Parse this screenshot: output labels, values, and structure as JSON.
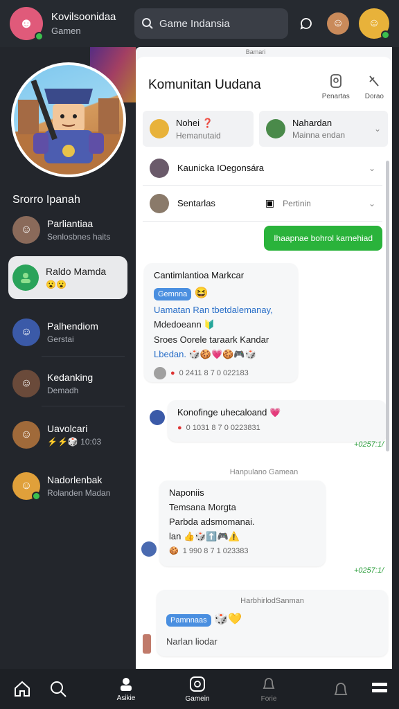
{
  "header": {
    "user_name": "Kovilsoonidaa",
    "user_sub": "Gamen",
    "search_text": "Game Indansia"
  },
  "sidebar": {
    "heading": "Srorro Ipanah",
    "items": [
      {
        "title": "Parliantiaa",
        "sub": "Senlosbnes haits"
      },
      {
        "title": "Raldo Mamda",
        "sub": "😮😮"
      },
      {
        "title": "Palhendiom",
        "sub": "Gerstai"
      },
      {
        "title": "Kedanking",
        "sub": "Demadh"
      },
      {
        "title": "Uavolcari",
        "sub": "⚡⚡🎲 10:03"
      },
      {
        "title": "Nadorlenbak",
        "sub": "Rolanden Madan"
      }
    ]
  },
  "panel": {
    "tag": "Bamari",
    "title": "Komunitan Uudana",
    "action1": "Penartas",
    "action2": "Dorao",
    "contact1": {
      "name": "Nohei ❓",
      "sub": "Hemanutaid"
    },
    "contact2": {
      "name": "Nahardan",
      "sub": "Mainna endan"
    },
    "contact3": {
      "name": "Kaunicka IOegonsára"
    },
    "contact4": {
      "name": "Sentarlas",
      "tag": "Pertinin"
    },
    "outgoing": "Ihaapnae bohrol karnehiad",
    "msg1": {
      "head": "Cantimlantioa Markcar",
      "pill": "Gemnna",
      "line1": "Uamatan Ran  tbetdalemanay,",
      "line2": "Mdedoeann 🔰",
      "line3": "Sroes Oorele taraark Kandar",
      "line4": "Lbedan.",
      "time": "0 2411 8 7 0 022183"
    },
    "msg2": {
      "head": "Konofinge uhecaloand 💗",
      "time": "0 1031 8 7 0 0223831",
      "stamp": "+0257:1/"
    },
    "sep1": "Hanpulano Gamean",
    "msg3": {
      "head": "Naponiis",
      "line1": "Temsana Morgta",
      "line2": "Parbda adsmomanai.",
      "line3": "lan 👍🎲⬆️🎮⚠️",
      "time": "1 990 8 7 1 023383",
      "stamp": "+0257:1/"
    },
    "msg4": {
      "head": "HarbhirlodSanman",
      "pill": "Pamnnaas",
      "line": "Narlan liodar"
    }
  },
  "nav": {
    "item3": "Asikie",
    "item4": "Gamein",
    "item5": "Forie"
  }
}
